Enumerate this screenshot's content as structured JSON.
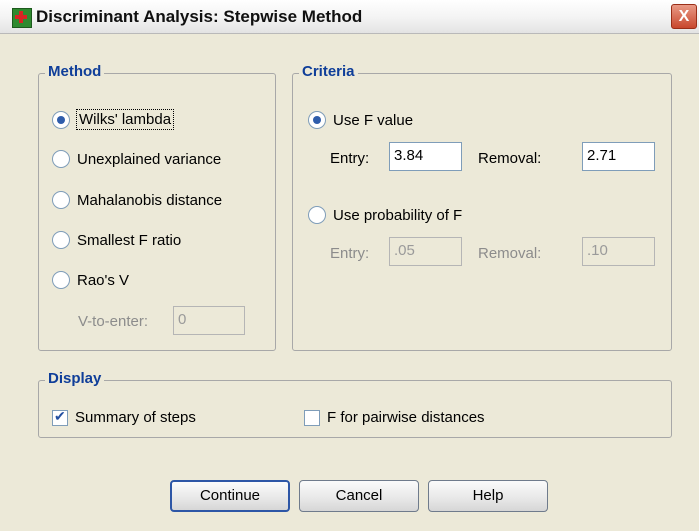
{
  "window": {
    "title": "Discriminant Analysis: Stepwise Method",
    "close_glyph": "X"
  },
  "method": {
    "legend": "Method",
    "options": [
      "Wilks' lambda",
      "Unexplained variance",
      "Mahalanobis distance",
      "Smallest F ratio",
      "Rao's V"
    ],
    "selected": "Wilks' lambda",
    "v_to_enter_label": "V-to-enter:",
    "v_to_enter_value": "0"
  },
  "criteria": {
    "legend": "Criteria",
    "use_f_value": {
      "label": "Use F value",
      "selected": true,
      "entry_label": "Entry:",
      "entry_value": "3.84",
      "removal_label": "Removal:",
      "removal_value": "2.71"
    },
    "use_probability": {
      "label": "Use probability of F",
      "selected": false,
      "entry_label": "Entry:",
      "entry_value": ".05",
      "removal_label": "Removal:",
      "removal_value": ".10"
    }
  },
  "display": {
    "legend": "Display",
    "summary_of_steps": {
      "label": "Summary of steps",
      "checked": true
    },
    "f_pairwise": {
      "label": "F for pairwise distances",
      "checked": false
    }
  },
  "buttons": {
    "continue": "Continue",
    "cancel": "Cancel",
    "help": "Help"
  },
  "colors": {
    "legend_text": "#0f3e99",
    "dialog_bg": "#ece9d8",
    "close_button": "#c8472d"
  }
}
